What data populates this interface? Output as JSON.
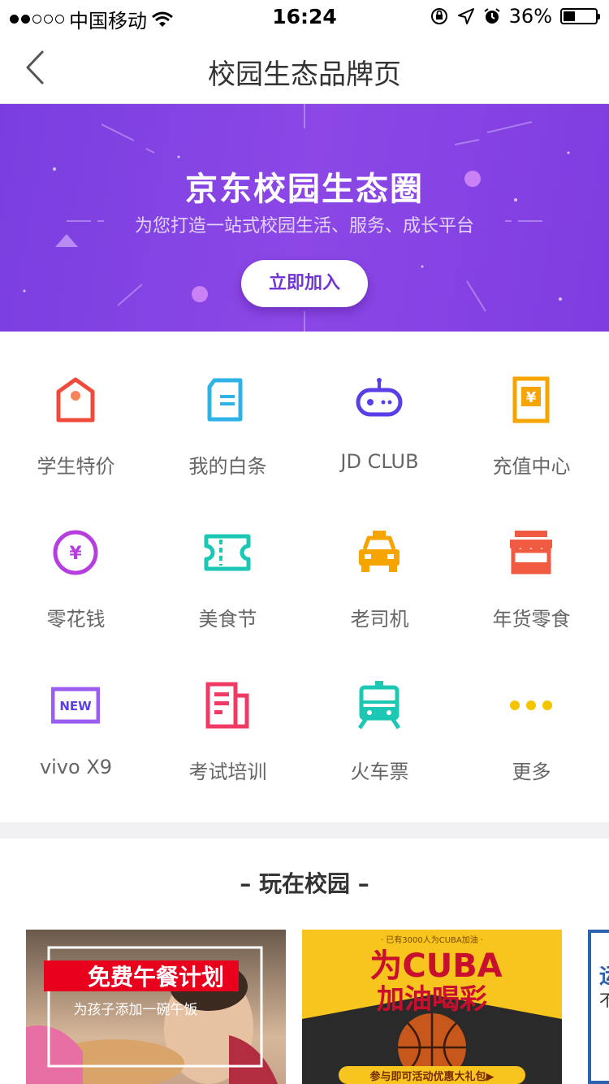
{
  "status_bar": {
    "carrier": "中国移动",
    "time": "16:24",
    "battery_percent_text": "36%",
    "battery_level": 0.36
  },
  "nav": {
    "title": "校园生态品牌页"
  },
  "banner": {
    "title": "京东校园生态圈",
    "subtitle": "为您打造一站式校园生活、服务、成长平台",
    "join_label": "立即加入"
  },
  "grid": {
    "items": [
      {
        "label": "学生特价",
        "icon": "price-tag-icon",
        "color": "#f04b3a"
      },
      {
        "label": "我的白条",
        "icon": "document-icon",
        "color": "#2fb3e6"
      },
      {
        "label": "JD CLUB",
        "icon": "game-controller-icon",
        "color": "#5a3ee6"
      },
      {
        "label": "充值中心",
        "icon": "yuan-card-icon",
        "color": "#f5a400"
      },
      {
        "label": "零花钱",
        "icon": "yuan-coin-icon",
        "color": "#b63ee0"
      },
      {
        "label": "美食节",
        "icon": "ticket-icon",
        "color": "#1cc8b4"
      },
      {
        "label": "老司机",
        "icon": "taxi-icon",
        "color": "#f5a400"
      },
      {
        "label": "年货零食",
        "icon": "store-icon",
        "color": "#f05a40"
      },
      {
        "label": "vivo X9",
        "icon": "new-badge-icon",
        "badge_text": "NEW",
        "color": "#9b5cf0"
      },
      {
        "label": "考试培训",
        "icon": "newspaper-icon",
        "color": "#ef3b63"
      },
      {
        "label": "火车票",
        "icon": "train-icon",
        "color": "#1cc8b4"
      },
      {
        "label": "更多",
        "icon": "more-dots-icon",
        "color": "#f5c400"
      }
    ]
  },
  "section": {
    "title": "– 玩在校园 –"
  },
  "cards": [
    {
      "title": "免费午餐计划",
      "subtitle": "为孩子添加一碗午饭"
    },
    {
      "top_text": "· 已有3000人为CUBA加油 ·",
      "title_line1": "为CUBA",
      "title_line2": "加油喝彩",
      "footer": "参与即可活动优惠大礼包▶"
    },
    {
      "partial_text_1": "运",
      "partial_text_2": "不"
    }
  ]
}
